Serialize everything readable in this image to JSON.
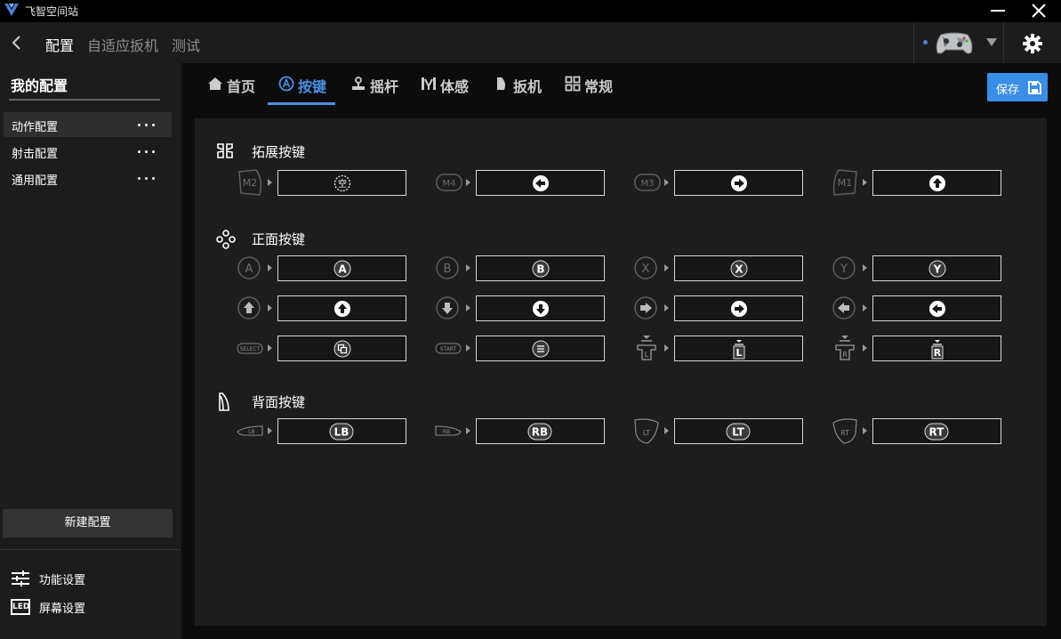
{
  "app": {
    "title": "飞智空间站"
  },
  "nav": {
    "links": [
      "配置",
      "自适应扳机",
      "测试"
    ]
  },
  "sidebar": {
    "title": "我的配置",
    "configs": [
      "动作配置",
      "射击配置",
      "通用配置"
    ],
    "new_config": "新建配置",
    "bottom": [
      {
        "label": "功能设置",
        "icon": "sliders-icon"
      },
      {
        "label": "屏幕设置",
        "icon": "led-icon",
        "icon_text": "LED"
      }
    ]
  },
  "tabs": [
    {
      "label": "首页",
      "icon": "home-icon"
    },
    {
      "label": "按键",
      "icon": "button-a-icon"
    },
    {
      "label": "摇杆",
      "icon": "joystick-icon"
    },
    {
      "label": "体感",
      "icon": "motion-icon"
    },
    {
      "label": "扳机",
      "icon": "trigger-icon"
    },
    {
      "label": "常规",
      "icon": "general-icon"
    }
  ],
  "active_tab": "按键",
  "save": {
    "label": "保存"
  },
  "sections": [
    {
      "title": "拓展按键",
      "icon": "extend-keys-icon"
    },
    {
      "title": "正面按键",
      "icon": "face-buttons-icon"
    },
    {
      "title": "背面按键",
      "icon": "back-buttons-icon"
    }
  ],
  "mappings": {
    "extend": [
      {
        "src": "M2",
        "target": "空"
      },
      {
        "src": "M4",
        "target": "arrow-left"
      },
      {
        "src": "M3",
        "target": "arrow-right"
      },
      {
        "src": "M1",
        "target": "arrow-up"
      }
    ],
    "face_row1": [
      {
        "src": "A",
        "target": "A"
      },
      {
        "src": "B",
        "target": "B"
      },
      {
        "src": "X",
        "target": "X"
      },
      {
        "src": "Y",
        "target": "Y"
      }
    ],
    "face_row2": [
      {
        "src": "dpad-up",
        "target": "arrow-up"
      },
      {
        "src": "dpad-down",
        "target": "arrow-down"
      },
      {
        "src": "dpad-right",
        "target": "arrow-right"
      },
      {
        "src": "dpad-left",
        "target": "arrow-left"
      }
    ],
    "face_row3": [
      {
        "src": "SELECT",
        "target": "view"
      },
      {
        "src": "START",
        "target": "menu"
      },
      {
        "src": "L",
        "target": "L"
      },
      {
        "src": "R",
        "target": "R"
      }
    ],
    "back": [
      {
        "src": "LB",
        "target": "LB"
      },
      {
        "src": "RB",
        "target": "RB"
      },
      {
        "src": "LT",
        "target": "LT"
      },
      {
        "src": "RT",
        "target": "RT"
      }
    ]
  }
}
